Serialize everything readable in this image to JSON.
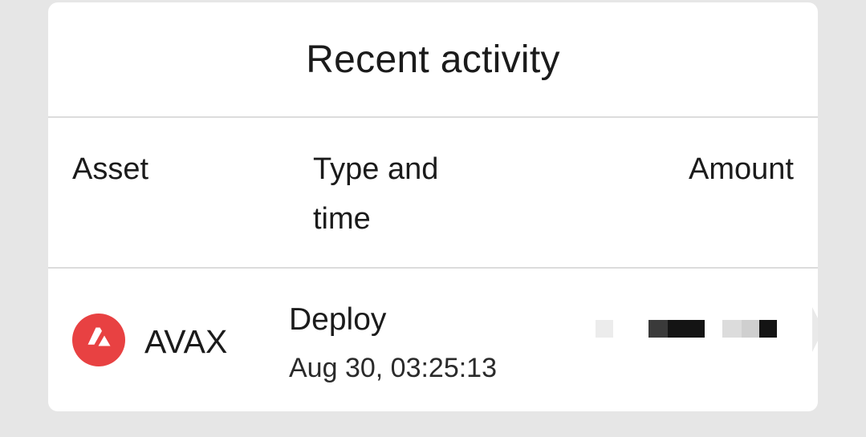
{
  "card": {
    "title": "Recent activity"
  },
  "table": {
    "headers": {
      "asset": "Asset",
      "type_time": "Type and time",
      "amount": "Amount"
    },
    "rows": [
      {
        "asset_icon": "avax-logo-icon",
        "asset": "AVAX",
        "type": "Deploy",
        "time": "Aug 30, 03:25:13",
        "amount": "",
        "amount_masked": true
      }
    ]
  },
  "colors": {
    "background": "#e6e6e6",
    "card": "#ffffff",
    "avax_brand": "#e84142",
    "divider": "#dcdcdc"
  }
}
